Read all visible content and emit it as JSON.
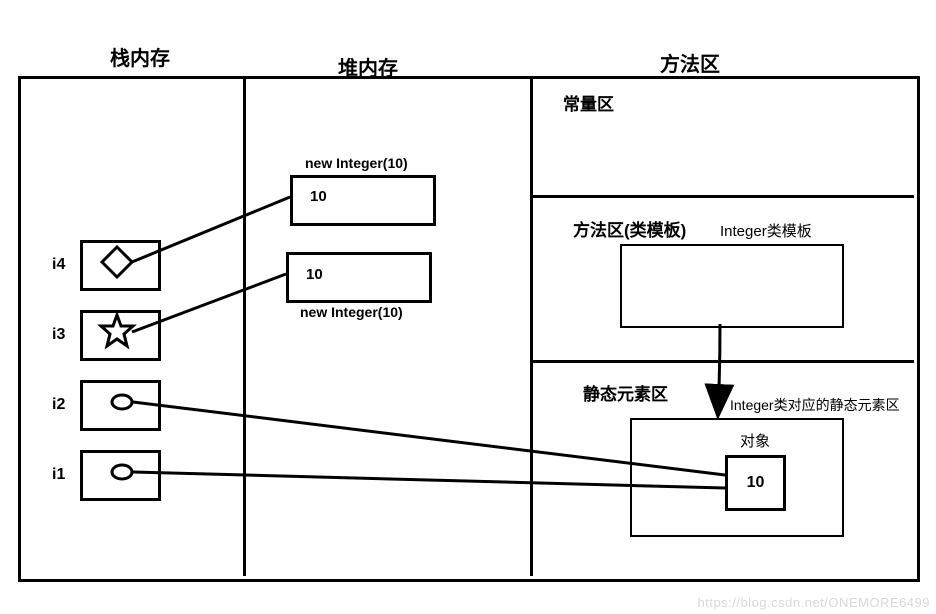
{
  "headers": {
    "stack": "栈内存",
    "heap": "堆内存",
    "method_area": "方法区"
  },
  "stack": {
    "i4": "i4",
    "i3": "i3",
    "i2": "i2",
    "i1": "i1"
  },
  "heap": {
    "box1_label": "new Integer(10)",
    "box1_value": "10",
    "box2_label": "new Integer(10)",
    "box2_value": "10"
  },
  "method_area": {
    "constant_pool": "常量区",
    "class_template_area": "方法区(类模板)",
    "class_template_label": "Integer类模板",
    "static_area": "静态元素区",
    "static_box_label": "Integer类对应的静态元素区",
    "object_label": "对象",
    "object_value": "10"
  },
  "watermark": "https://blog.csdn.net/ONEMORE6499"
}
